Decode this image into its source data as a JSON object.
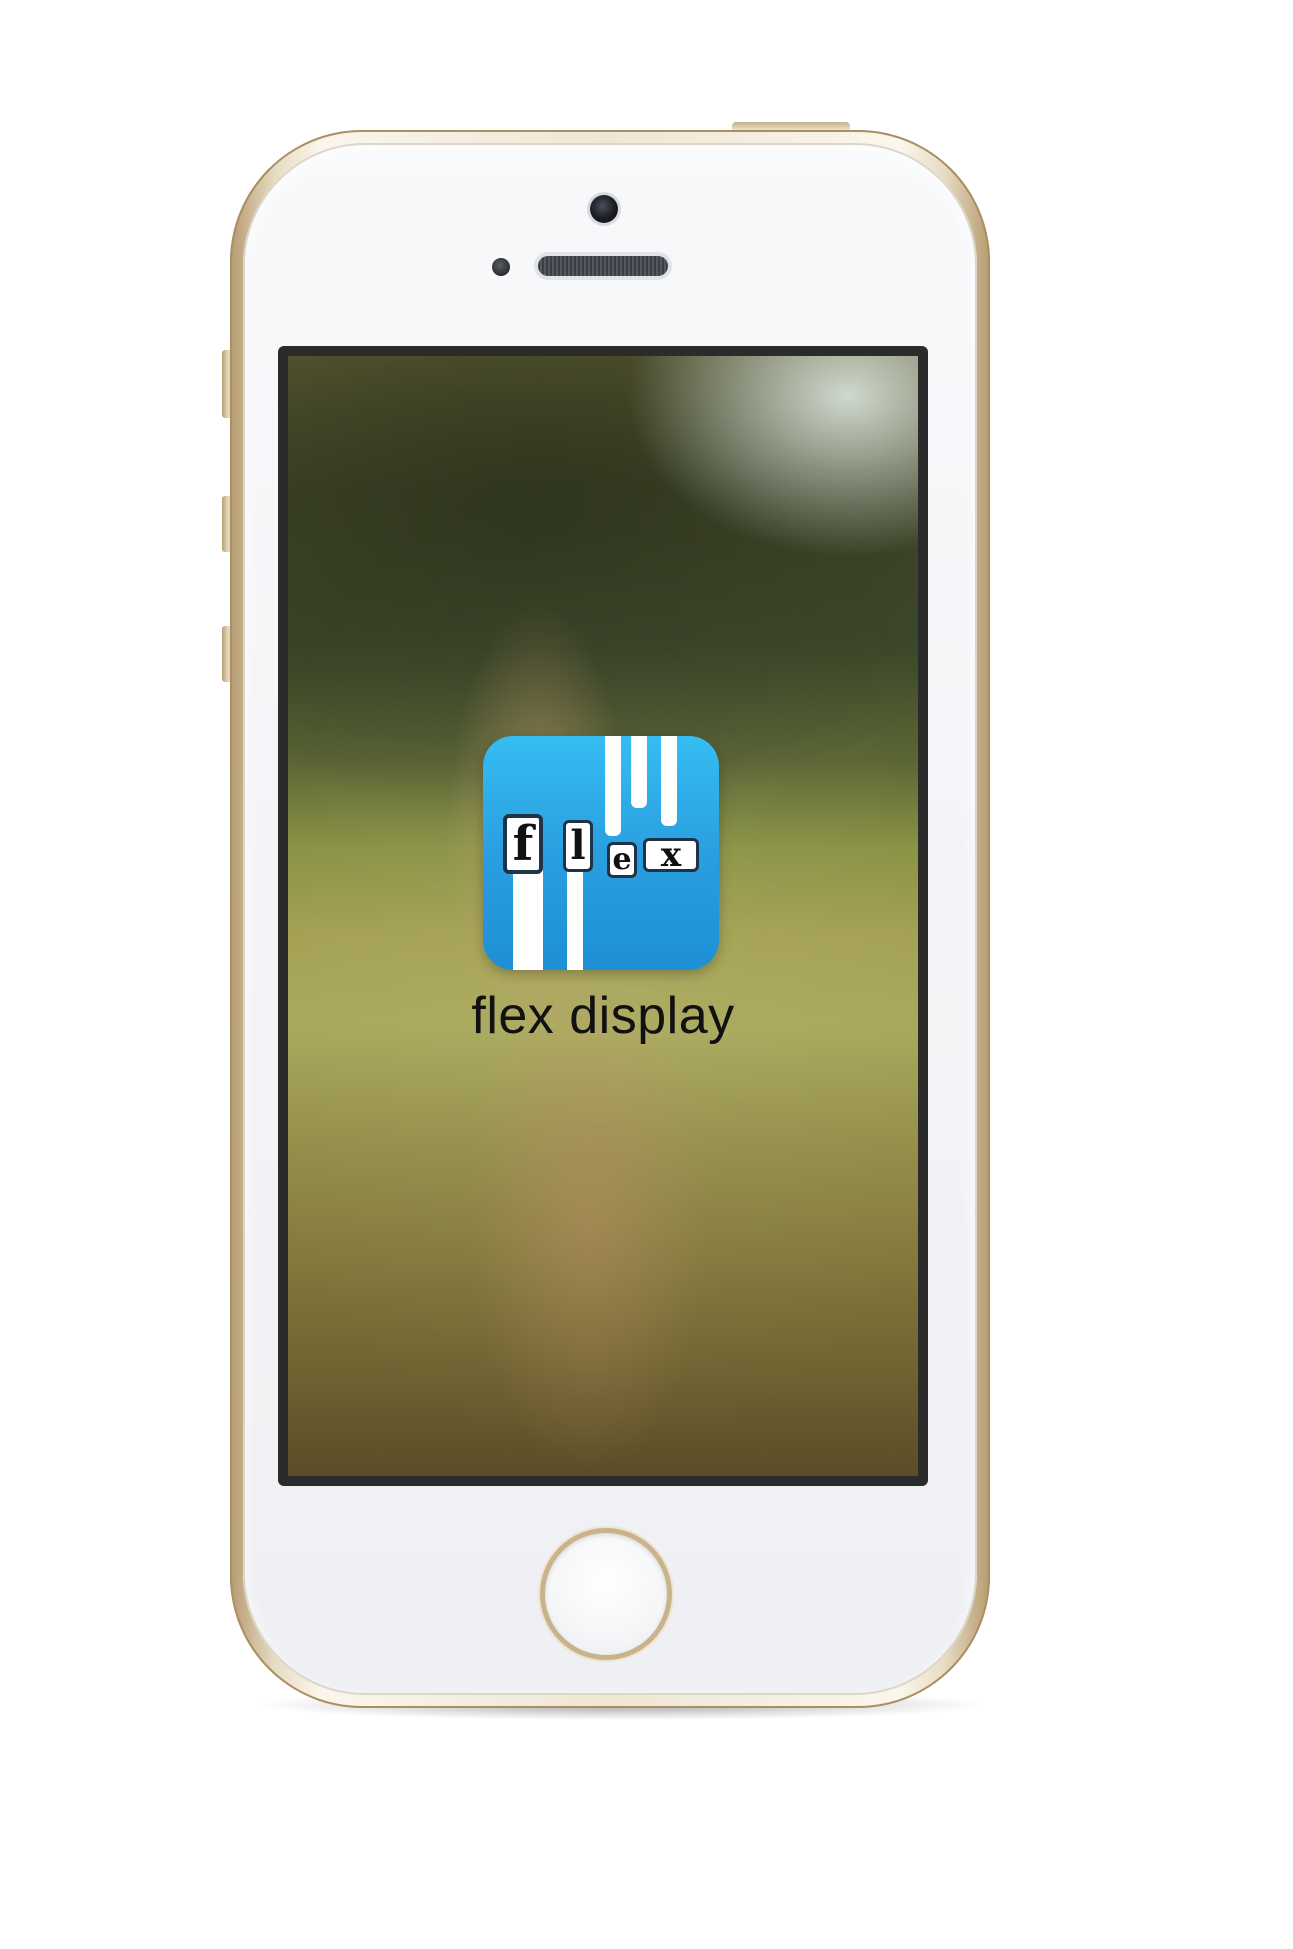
{
  "device": {
    "model": "iPhone",
    "finish_color": "#e8dcc4",
    "face_color": "#f4f5f8"
  },
  "home_screen": {
    "wallpaper": "blurred meadow photo",
    "app": {
      "name": "flex display",
      "icon_letters": [
        "f",
        "l",
        "e",
        "x"
      ],
      "icon_color": "#2aa3e4"
    }
  }
}
